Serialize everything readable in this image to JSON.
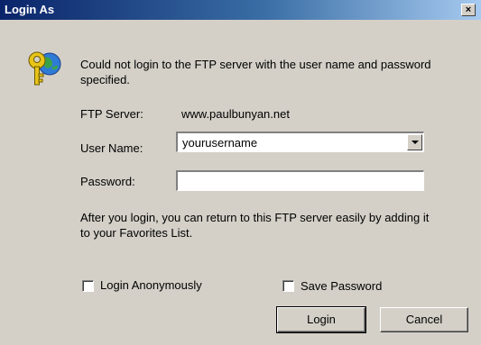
{
  "window": {
    "title": "Login As",
    "close_glyph": "×"
  },
  "message": "Could not login to the FTP server with the user name and password specified.",
  "server": {
    "label": "FTP Server:",
    "value": "www.paulbunyan.net"
  },
  "username": {
    "label": "User Name:",
    "value": "yourusername"
  },
  "password": {
    "label": "Password:",
    "value": ""
  },
  "info": "After you login, you can return to this FTP server easily by adding it to your Favorites List.",
  "options": {
    "anonymous_label": "Login Anonymously",
    "anonymous_checked": false,
    "save_password_label": "Save Password",
    "save_password_checked": false
  },
  "buttons": {
    "login": "Login",
    "cancel": "Cancel"
  },
  "icons": {
    "dialog_icon": "key-globe-icon",
    "close": "close-icon",
    "dropdown": "chevron-down-icon"
  },
  "colors": {
    "titlebar_start": "#0a246a",
    "titlebar_end": "#a6caf0",
    "dialog_bg": "#d4d0c8"
  }
}
